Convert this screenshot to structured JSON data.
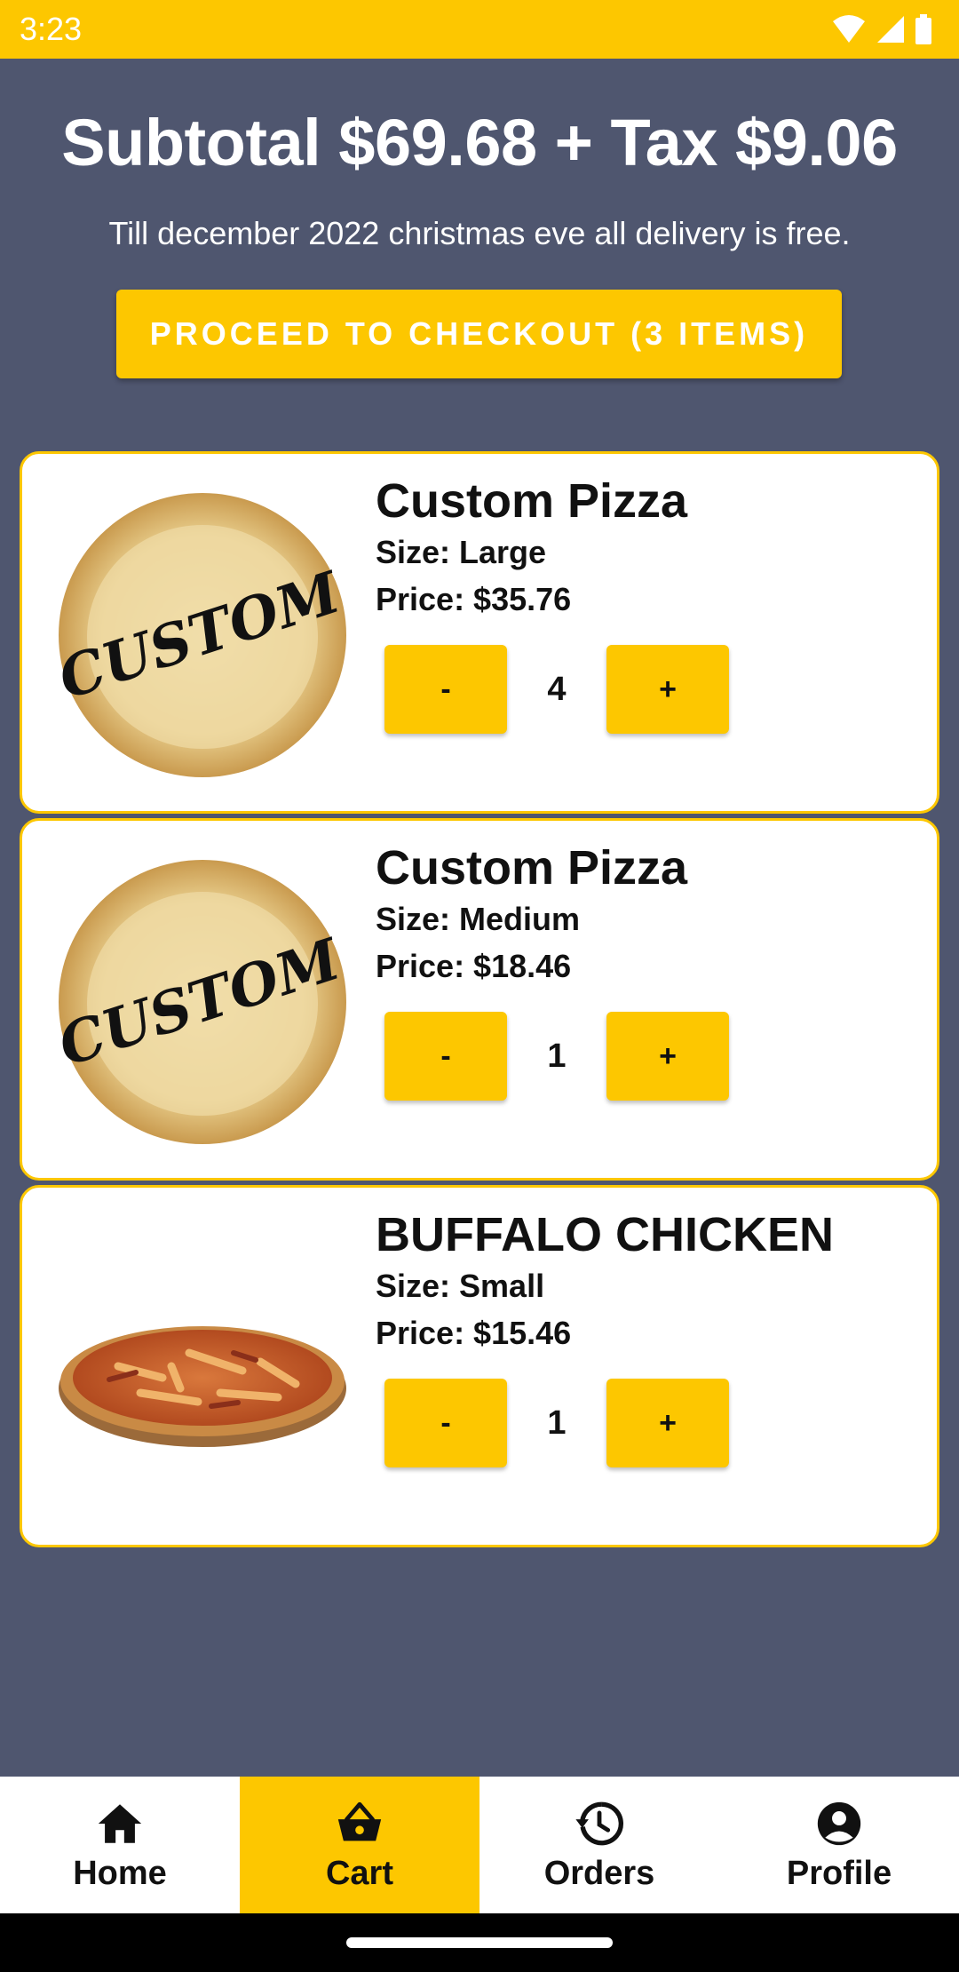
{
  "status_bar": {
    "time": "3:23",
    "icons": [
      "wifi-icon",
      "signal-icon",
      "battery-icon"
    ]
  },
  "summary": {
    "title": "Subtotal $69.68 + Tax $9.06",
    "promo": "Till december 2022 christmas eve all delivery is free.",
    "checkout_label": "PROCEED TO CHECKOUT (3 ITEMS)"
  },
  "cart": {
    "items": [
      {
        "name": "Custom Pizza",
        "size": "Size: Large",
        "price": "Price: $35.76",
        "quantity": "4",
        "minus_label": "-",
        "plus_label": "+",
        "image": "custom-pizza-crust-image",
        "image_text": "CUSTOM"
      },
      {
        "name": "Custom Pizza",
        "size": "Size: Medium",
        "price": "Price: $18.46",
        "quantity": "1",
        "minus_label": "-",
        "plus_label": "+",
        "image": "custom-pizza-crust-image",
        "image_text": "CUSTOM"
      },
      {
        "name": "BUFFALO CHICKEN",
        "size": "Size: Small",
        "price": "Price: $15.46",
        "quantity": "1",
        "minus_label": "-",
        "plus_label": "+",
        "image": "buffalo-chicken-pizza-image"
      }
    ]
  },
  "nav": {
    "items": [
      {
        "label": "Home",
        "icon": "home-icon",
        "active": false
      },
      {
        "label": "Cart",
        "icon": "basket-icon",
        "active": true
      },
      {
        "label": "Orders",
        "icon": "history-icon",
        "active": false
      },
      {
        "label": "Profile",
        "icon": "account-circle-icon",
        "active": false
      }
    ]
  },
  "colors": {
    "accent": "#fdc700",
    "background": "#4f566f",
    "card": "#ffffff",
    "text_dark": "#111111",
    "gesture_bar": "#000000"
  }
}
